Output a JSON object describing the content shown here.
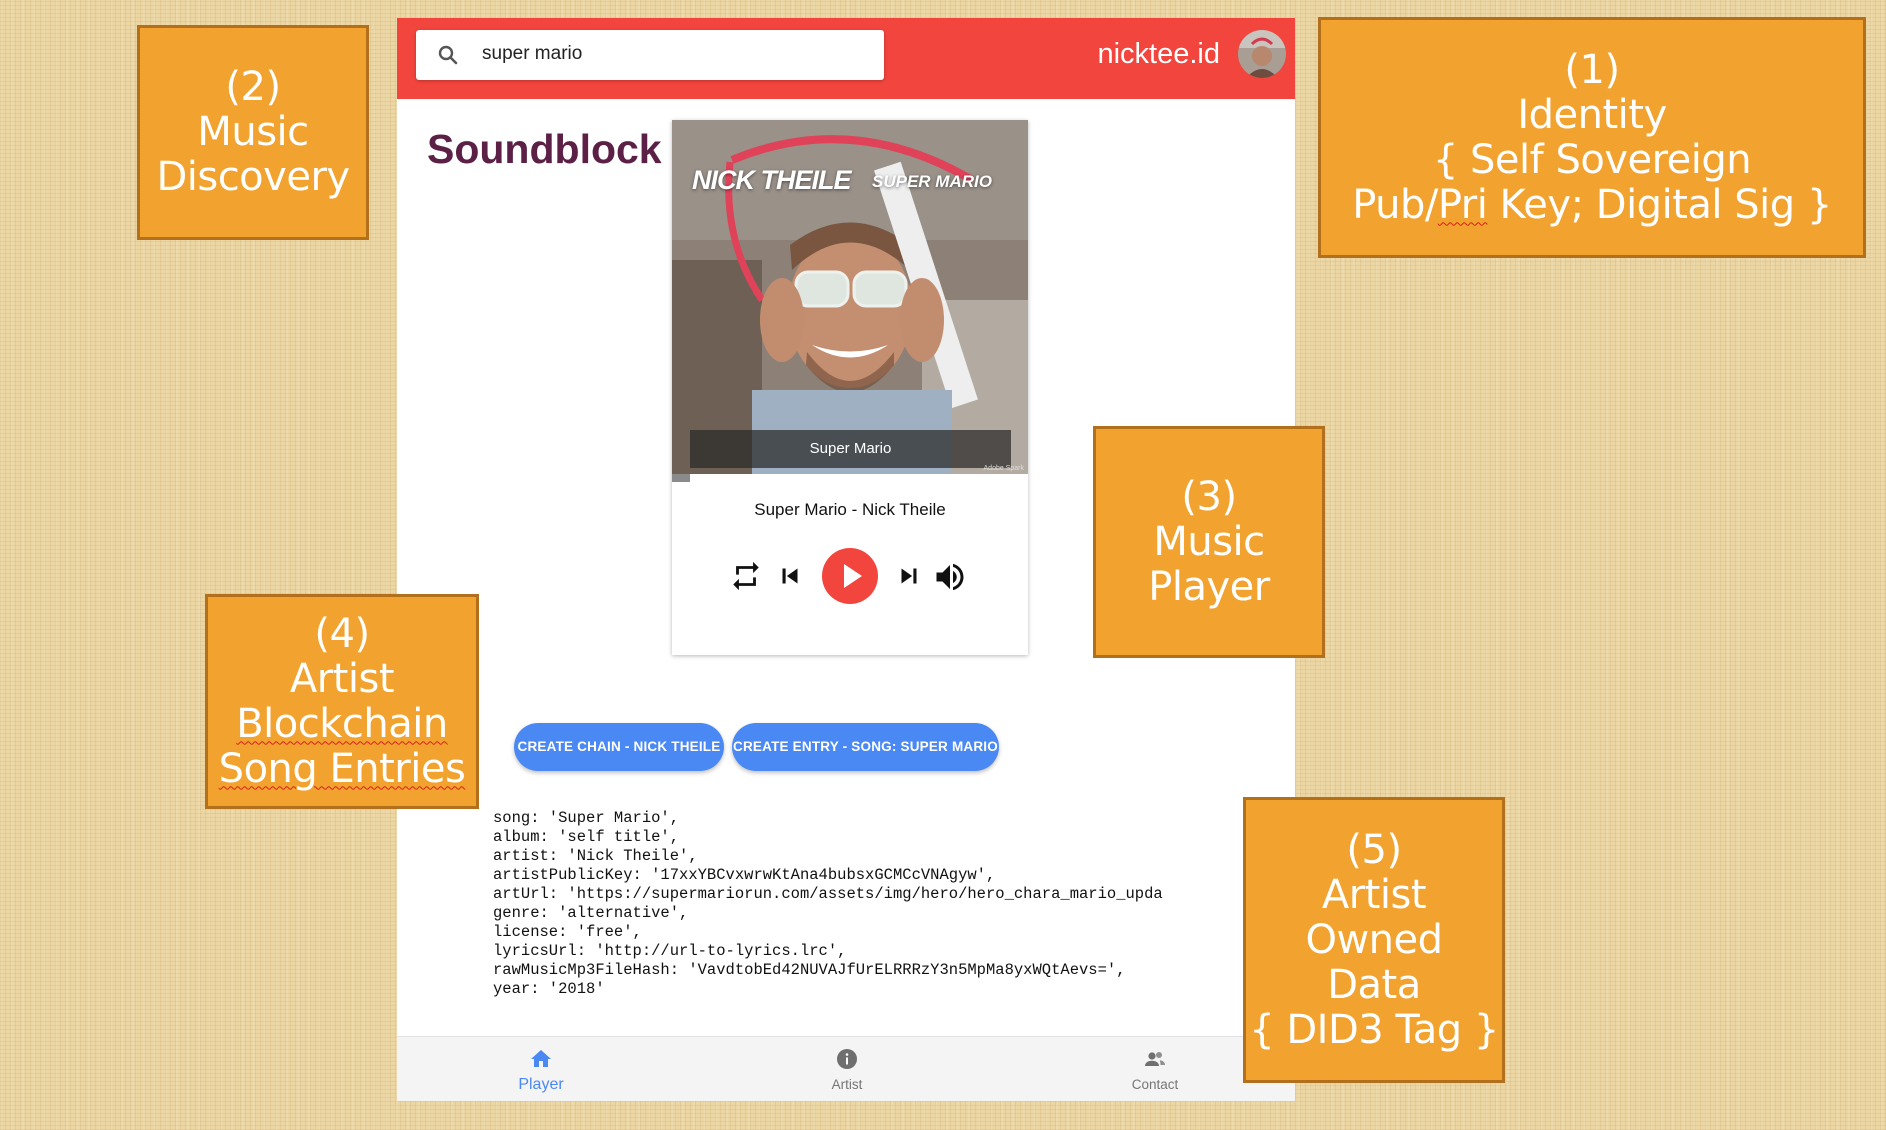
{
  "app": {
    "search": {
      "value": "super mario"
    },
    "user": {
      "name": "nicktee.id"
    },
    "brand": "Soundblock",
    "cover": {
      "artist_text": "NICK THEILE",
      "song_text": "SUPER MARIO",
      "caption": "Super Mario",
      "credit": "Adobe Spark"
    },
    "player": {
      "now_playing": "Super Mario - Nick Theile",
      "progress": 0.05
    },
    "actions": {
      "create_chain": "CREATE CHAIN - NICK THEILE",
      "create_entry": "CREATE ENTRY - SONG: SUPER MARIO"
    },
    "metadata_lines": [
      "song: 'Super Mario',",
      "album: 'self title',",
      "artist: 'Nick Theile',",
      "artistPublicKey: '17xxYBCvxwrwKtAna4bubsxGCMCcVNAgyw',",
      "artUrl: 'https://supermariorun.com/assets/img/hero/hero_chara_mario_upda",
      "genre: 'alternative',",
      "license: 'free',",
      "lyricsUrl: 'http://url-to-lyrics.lrc',",
      "rawMusicMp3FileHash: 'VavdtobEd42NUVAJfUrELRRRzY3n5MpMa8yxWQtAevs=',",
      "year: '2018'"
    ],
    "bottom_nav": [
      {
        "label": "Player",
        "icon": "home-icon",
        "active": true
      },
      {
        "label": "Artist",
        "icon": "info-icon",
        "active": false
      },
      {
        "label": "Contact",
        "icon": "contacts-icon",
        "active": false
      }
    ],
    "colors": {
      "appbar": "#f2453d",
      "accent": "#4a89f3",
      "brand": "#5c2046",
      "note_fill": "#f2a22e"
    }
  },
  "annotations": {
    "identity": {
      "line1": "(1)",
      "line2": "Identity",
      "line3": "{ Self Sovereign",
      "line4_a": "Pub/",
      "line4_b": "Pri",
      "line4_c": " Key; Digital Sig }"
    },
    "discovery": {
      "text": "(2)\nMusic\nDiscovery"
    },
    "player": {
      "text": "(3)\nMusic\nPlayer"
    },
    "blockchain": {
      "line1": "(4)",
      "line2": "Artist",
      "line3": "Blockchain",
      "line4": "Song Entries"
    },
    "owned": {
      "text": "(5)\nArtist\nOwned\nData\n{ DID3 Tag }"
    }
  }
}
